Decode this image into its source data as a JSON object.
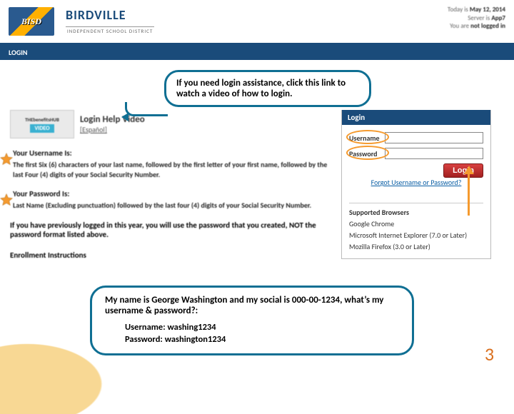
{
  "header": {
    "bisd_abbr": "BISD",
    "district_name": "BIRDVILLE",
    "district_sub": "INDEPENDENT SCHOOL DISTRICT",
    "status_date_label": "Today is",
    "status_date": "May 12, 2014",
    "status_server_label": "Server is",
    "status_server": "App7",
    "status_login_label": "You are",
    "status_login": "not logged in"
  },
  "tabbar": {
    "login": "LOGIN"
  },
  "callouts": {
    "top": "If you need login assistance, click this link to watch a video of how to login.",
    "bottom_q": "My name is George Washington and my social is 000-00-1234, what’s my username & password?:",
    "bottom_a1": "Username: washing1234",
    "bottom_a2": "Password: washington1234"
  },
  "help_video": {
    "badge_line1": "THEbenefitsHUB",
    "badge_line2": "VIDEO",
    "title": "Login Help Video",
    "espanol": "[Español]"
  },
  "username_help": {
    "heading": "Your Username Is:",
    "body": "The first Six (6) characters of your last name, followed by the first letter of your first name, followed by the last Four (4) digits of your Social Security Number."
  },
  "password_help": {
    "heading": "Your Password Is:",
    "body": "Last Name (Excluding punctuation) followed by the last four (4) digits of your Social Security Number."
  },
  "prev_login": {
    "heading": "If you have previously logged in this year, you will use the password that you created, NOT the password format listed above."
  },
  "enroll": {
    "heading": "Enrollment Instructions"
  },
  "login_box": {
    "title": "Login",
    "username_label": "Username",
    "password_label": "Password",
    "username_value": "",
    "password_value": "",
    "button": "Login",
    "forgot": "Forgot Username or Password?",
    "browsers_heading": "Supported Browsers",
    "browser1": "Google Chrome",
    "browser2": "Microsoft Internet Explorer (7.0 or Later)",
    "browser3": "Mozilla Firefox (3.0 or Later)"
  },
  "page_number": "3"
}
